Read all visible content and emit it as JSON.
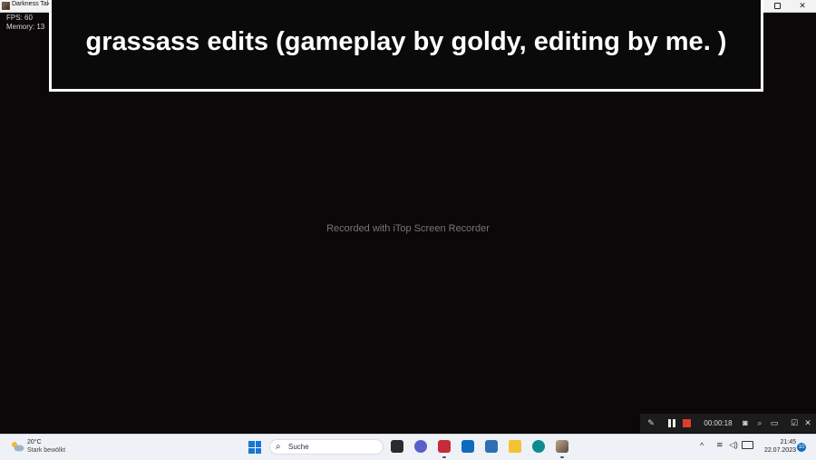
{
  "window": {
    "title": "Darkness Tak",
    "maximize_glyph": "",
    "close_glyph": "✕"
  },
  "overlay": {
    "fps": "FPS: 60",
    "memory": "Memory: 13"
  },
  "banner": {
    "caption": "grassass edits (gameplay by goldy, editing by me. )"
  },
  "watermark": "Recorded with iTop Screen Recorder",
  "recorder": {
    "timer": "00:00:18",
    "pen_glyph": "✎",
    "camera_glyph": "◙",
    "zoom_glyph": "⌕",
    "chat_glyph": "▭",
    "edit_glyph": "☑",
    "close_glyph": "✕",
    "stop_color": "#e23b2e"
  },
  "taskbar": {
    "weather": {
      "temp": "20°C",
      "desc": "Stark bewölkt",
      "icon": "cloud-sun-icon"
    },
    "search": {
      "placeholder": "Suche",
      "icon_glyph": "⌕"
    },
    "apps": [
      "task-view-icon",
      "teams-icon",
      "recorder-app-icon",
      "mail-icon",
      "store-icon",
      "file-explorer-icon",
      "edge-icon",
      "game-app-icon"
    ],
    "tray": {
      "up_glyph": "^",
      "wifi_glyph": "≋",
      "volume_glyph": "◁)"
    },
    "clock": {
      "time": "21:45",
      "date": "22.07.2023"
    },
    "notifications": "10",
    "accent": "#0f6cbd"
  }
}
